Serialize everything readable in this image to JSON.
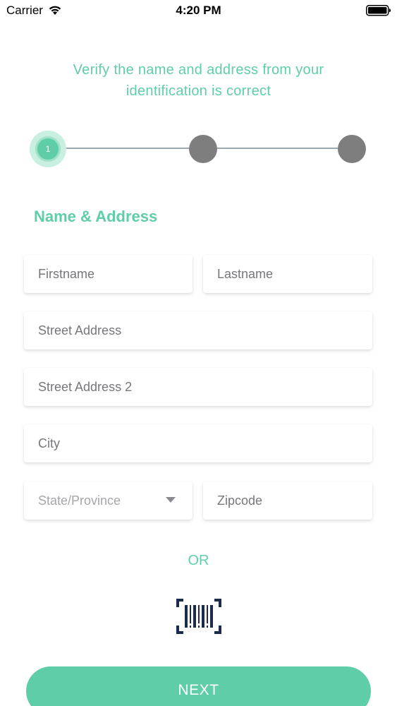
{
  "status_bar": {
    "carrier": "Carrier",
    "time": "4:20 PM",
    "wifi_icon": "wifi-icon",
    "battery_icon": "battery-icon"
  },
  "instructions": {
    "line1": "Verify the name and address from your",
    "line2": "identification is correct"
  },
  "stepper": {
    "current_step": 1,
    "total_steps": 3,
    "active_label": "1"
  },
  "section_title": "Name & Address",
  "form": {
    "firstname_placeholder": "Firstname",
    "lastname_placeholder": "Lastname",
    "street_placeholder": "Street Address",
    "street2_placeholder": "Street Address 2",
    "city_placeholder": "City",
    "state_placeholder": "State/Province",
    "zip_placeholder": "Zipcode"
  },
  "or_text": "OR",
  "barcode_icon": "barcode-scan-icon",
  "next_label": "NEXT",
  "colors": {
    "accent": "#5fcea8",
    "inactive_step": "#7e7e7e",
    "barcode": "#1d2b4a"
  }
}
